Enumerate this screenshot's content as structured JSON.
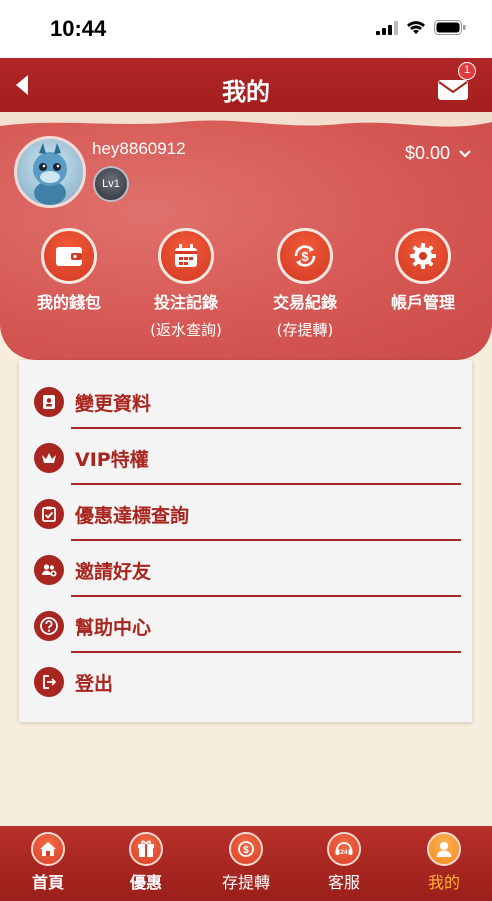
{
  "status": {
    "time": "10:44"
  },
  "header": {
    "title": "我的",
    "mail_badge": "1"
  },
  "profile": {
    "username": "hey8860912",
    "level": "Lv1",
    "balance": "$0.00"
  },
  "quick_actions": [
    {
      "label": "我的錢包",
      "sub": "",
      "icon": "wallet-icon"
    },
    {
      "label": "投注記錄",
      "sub": "(返水查詢)",
      "icon": "calendar-icon"
    },
    {
      "label": "交易紀錄",
      "sub": "(存提轉)",
      "icon": "dollar-cycle-icon"
    },
    {
      "label": "帳戶管理",
      "sub": "",
      "icon": "gear-icon"
    }
  ],
  "menu": [
    {
      "label": "變更資料",
      "icon": "profile-card-icon"
    },
    {
      "label": "VIP特權",
      "icon": "crown-icon"
    },
    {
      "label": "優惠達標查詢",
      "icon": "checklist-icon"
    },
    {
      "label": "邀請好友",
      "icon": "invite-friends-icon"
    },
    {
      "label": "幫助中心",
      "icon": "help-icon"
    },
    {
      "label": "登出",
      "icon": "logout-icon"
    }
  ],
  "bottom_nav": [
    {
      "label": "首頁",
      "icon": "home-icon"
    },
    {
      "label": "優惠",
      "icon": "gift-icon"
    },
    {
      "label": "存提轉",
      "icon": "money-transfer-icon"
    },
    {
      "label": "客服",
      "icon": "support-24-icon"
    },
    {
      "label": "我的",
      "icon": "user-icon",
      "active": true
    }
  ],
  "colors": {
    "primary_red": "#a8261f",
    "active_nav": "#ffb02e",
    "background": "#f6eddc"
  }
}
